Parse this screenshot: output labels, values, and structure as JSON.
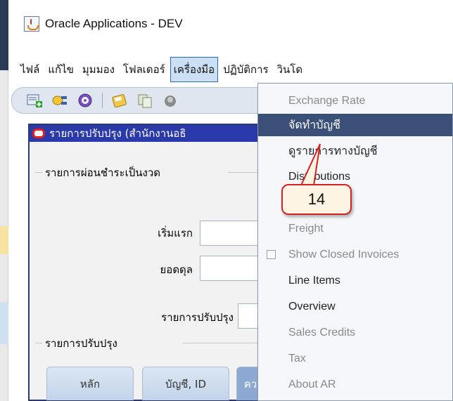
{
  "window": {
    "title": "Oracle Applications - DEV"
  },
  "menubar": {
    "items": [
      {
        "label": "ไฟล์"
      },
      {
        "label": "แก้ไข"
      },
      {
        "label": "มุมมอง"
      },
      {
        "label": "โฟลเดอร์"
      },
      {
        "label": "เครื่องมือ"
      },
      {
        "label": "ปฏิบัติการ"
      },
      {
        "label": "วินโด"
      }
    ]
  },
  "toolbar": {
    "icons": [
      "new-record-icon",
      "find-icon",
      "navigate-icon",
      "save-icon",
      "attachments-icon",
      "translate-icon"
    ]
  },
  "form": {
    "title": "รายการปรับปรุง (สำนักงานอธิ",
    "group_installments": "รายการผ่อนชำระเป็นงวด",
    "label_first": "เริ่มแรก",
    "label_balance": "ยอดดุล",
    "label_adjustment": "รายการปรับปรุง",
    "group_adjustments": "รายการปรับปรุง",
    "tabs": [
      {
        "label": "หลัก"
      },
      {
        "label": "บัญชี, ID"
      },
      {
        "label": "คว"
      }
    ]
  },
  "tools_menu": {
    "items": [
      {
        "label": "Exchange Rate",
        "enabled": false
      },
      {
        "label": "จัดทำบัญชี",
        "enabled": true,
        "highlighted": true
      },
      {
        "label": "ดูรายการทางบัญชี",
        "enabled": true
      },
      {
        "label": "Distributions",
        "enabled": true
      },
      {
        "label": "",
        "enabled": false
      },
      {
        "label": "Freight",
        "enabled": false
      },
      {
        "label": "Show Closed Invoices",
        "enabled": false,
        "checkbox": true
      },
      {
        "label": "Line Items",
        "enabled": true
      },
      {
        "label": "Overview",
        "enabled": true
      },
      {
        "label": "Sales Credits",
        "enabled": false
      },
      {
        "label": "Tax",
        "enabled": false
      },
      {
        "label": "About AR",
        "enabled": false
      }
    ]
  },
  "callout": {
    "number": "14"
  }
}
